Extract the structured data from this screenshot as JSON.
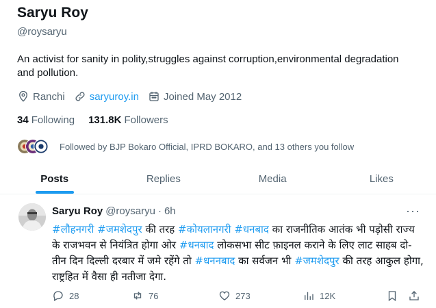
{
  "profile": {
    "display_name": "Saryu Roy",
    "handle": "@roysaryu",
    "bio": "An activist for sanity in polity,struggles against corruption,environmental degradation and pollution.",
    "location": "Ranchi",
    "website": "saryuroy.in",
    "joined": "Joined May 2012",
    "following_count": "34",
    "following_label": "Following",
    "followers_count": "131.8K",
    "followers_label": "Followers",
    "followed_by": "Followed by BJP Bokaro Official, IPRD BOKARO, and 13 others you follow"
  },
  "tabs": [
    {
      "label": "Posts",
      "active": true
    },
    {
      "label": "Replies",
      "active": false
    },
    {
      "label": "Media",
      "active": false
    },
    {
      "label": "Likes",
      "active": false
    }
  ],
  "tweet": {
    "name": "Saryu Roy",
    "handle": "@roysaryu",
    "separator": "·",
    "time": "6h",
    "more": "···",
    "text_parts": [
      {
        "t": "#लौहनगरी",
        "tag": true
      },
      {
        "t": " ",
        "tag": false
      },
      {
        "t": "#जमशेदपुर",
        "tag": true
      },
      {
        "t": " की तरह ",
        "tag": false
      },
      {
        "t": "#कोयलानगरी",
        "tag": true
      },
      {
        "t": " ",
        "tag": false
      },
      {
        "t": "#धनबाद",
        "tag": true
      },
      {
        "t": " का राजनीतिक आतंक भी पड़ोसी राज्य के राजभवन से नियंत्रित होगा ओर ",
        "tag": false
      },
      {
        "t": "#धनबाद",
        "tag": true
      },
      {
        "t": " लोकसभा सीट फ़ाइनल कराने के लिए लाट साहब दो-तीन दिन दिल्ली दरबार में जमे रहेंगे तो ",
        "tag": false
      },
      {
        "t": "#धननबाद",
        "tag": true
      },
      {
        "t": " का सर्वजन भी ",
        "tag": false
      },
      {
        "t": "#जमशेदपुर",
        "tag": true
      },
      {
        "t": " की तरह आकुल होगा, राष्ट्रहित में वैसा ही नतीजा देगा.",
        "tag": false
      }
    ],
    "replies": "28",
    "reposts": "76",
    "likes": "273",
    "views": "12K"
  },
  "colors": {
    "accent": "#1d9bf0",
    "muted": "#536471",
    "text": "#0f1419"
  }
}
